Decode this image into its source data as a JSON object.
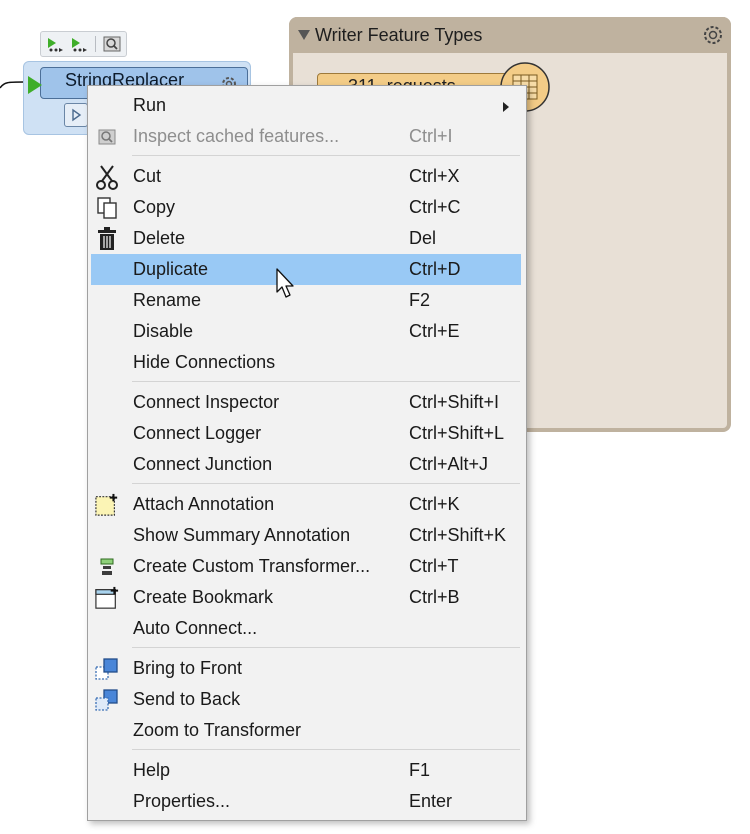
{
  "canvas": {
    "transformer": {
      "name": "StringReplacer"
    },
    "writer_panel": {
      "title": "Writer Feature Types",
      "feature_type": "311_requests"
    }
  },
  "menu": {
    "items": [
      {
        "id": "run",
        "label": "Run",
        "shortcut": "",
        "submenu": true
      },
      {
        "id": "inspect",
        "label": "Inspect cached features...",
        "shortcut": "Ctrl+I",
        "disabled": true,
        "icon": "inspect-icon"
      },
      {
        "id": "cut",
        "label": "Cut",
        "shortcut": "Ctrl+X",
        "icon": "scissors-icon"
      },
      {
        "id": "copy",
        "label": "Copy",
        "shortcut": "Ctrl+C",
        "icon": "copy-icon"
      },
      {
        "id": "delete",
        "label": "Delete",
        "shortcut": "Del",
        "icon": "trash-icon"
      },
      {
        "id": "duplicate",
        "label": "Duplicate",
        "shortcut": "Ctrl+D",
        "highlighted": true
      },
      {
        "id": "rename",
        "label": "Rename",
        "shortcut": "F2"
      },
      {
        "id": "disable",
        "label": "Disable",
        "shortcut": "Ctrl+E"
      },
      {
        "id": "hide_connections",
        "label": "Hide Connections",
        "shortcut": ""
      },
      {
        "id": "connect_inspector",
        "label": "Connect Inspector",
        "shortcut": "Ctrl+Shift+I"
      },
      {
        "id": "connect_logger",
        "label": "Connect Logger",
        "shortcut": "Ctrl+Shift+L"
      },
      {
        "id": "connect_junction",
        "label": "Connect Junction",
        "shortcut": "Ctrl+Alt+J"
      },
      {
        "id": "attach_annotation",
        "label": "Attach Annotation",
        "shortcut": "Ctrl+K",
        "icon": "annotation-icon"
      },
      {
        "id": "show_summary_annotation",
        "label": "Show Summary Annotation",
        "shortcut": "Ctrl+Shift+K"
      },
      {
        "id": "create_custom_transformer",
        "label": "Create Custom Transformer...",
        "shortcut": "Ctrl+T",
        "icon": "custom-transformer-icon"
      },
      {
        "id": "create_bookmark",
        "label": "Create Bookmark",
        "shortcut": "Ctrl+B",
        "icon": "bookmark-icon"
      },
      {
        "id": "auto_connect",
        "label": "Auto Connect...",
        "shortcut": ""
      },
      {
        "id": "bring_to_front",
        "label": "Bring to Front",
        "shortcut": "",
        "icon": "bring-front-icon"
      },
      {
        "id": "send_to_back",
        "label": "Send to Back",
        "shortcut": "",
        "icon": "send-back-icon"
      },
      {
        "id": "zoom_to_transformer",
        "label": "Zoom to Transformer",
        "shortcut": ""
      },
      {
        "id": "help",
        "label": "Help",
        "shortcut": "F1"
      },
      {
        "id": "properties",
        "label": "Properties...",
        "shortcut": "Enter"
      }
    ]
  },
  "colors": {
    "highlight": "#99c9f5",
    "menu_background": "#f2f2f2",
    "writer_header": "#bfb29f",
    "transformer_header": "#9fc3ea"
  }
}
